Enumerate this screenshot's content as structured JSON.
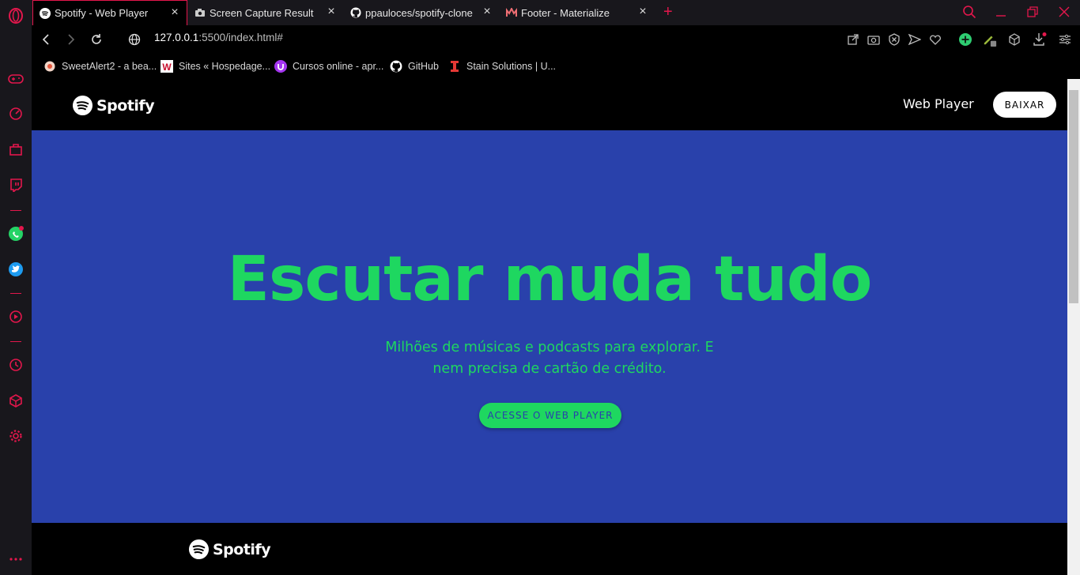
{
  "browser": {
    "tabs": [
      {
        "title": "Spotify - Web Player",
        "active": true
      },
      {
        "title": "Screen Capture Result",
        "active": false
      },
      {
        "title": "ppauloces/spotify-clone",
        "active": false
      },
      {
        "title": "Footer - Materialize",
        "active": false
      }
    ],
    "new_tab_label": "+",
    "url_host": "127.0.0.1",
    "url_path": ":5500/index.html#",
    "bookmarks": [
      {
        "label": "SweetAlert2 - a bea...",
        "icon": "sweetalert-icon"
      },
      {
        "label": "Sites « Hospedage...",
        "icon": "w-icon"
      },
      {
        "label": "Cursos online - apr...",
        "icon": "udemy-icon"
      },
      {
        "label": "GitHub",
        "icon": "github-icon"
      },
      {
        "label": "Stain Solutions | U...",
        "icon": "stain-icon"
      }
    ],
    "accent_color": "#e3174c"
  },
  "site": {
    "logo_text": "Spotify",
    "nav_link": "Web Player",
    "download_button": "BAIXAR",
    "hero_title": "Escutar muda tudo",
    "hero_subtitle": "Milhões de músicas e podcasts para explorar. E nem precisa de cartão de crédito.",
    "cta_button": "ACESSE O WEB PLAYER",
    "footer_logo_text": "Spotify",
    "colors": {
      "hero_bg": "#2941ab",
      "brand_green": "#1ed760",
      "header_bg": "#000000"
    }
  }
}
